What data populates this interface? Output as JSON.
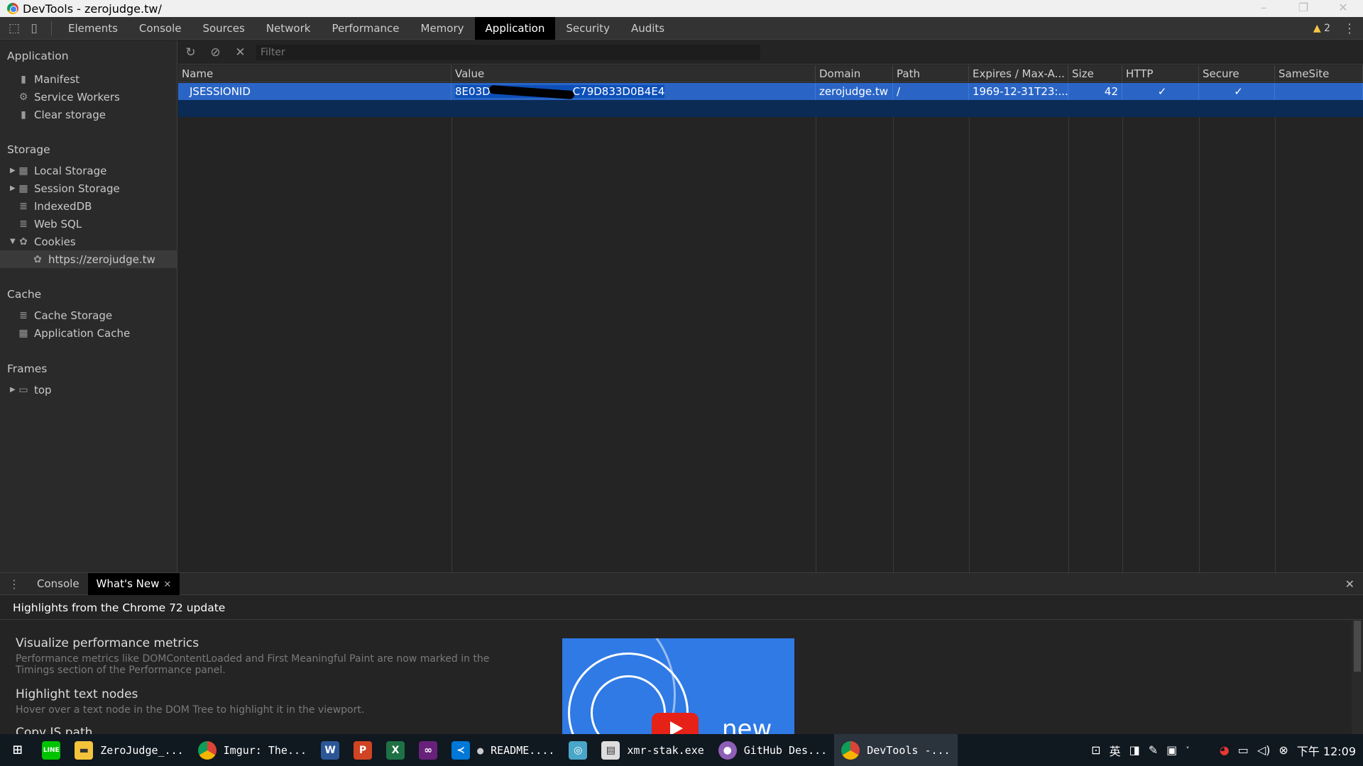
{
  "window": {
    "title": "DevTools - zerojudge.tw/"
  },
  "toolbar": {
    "tabs": [
      "Elements",
      "Console",
      "Sources",
      "Network",
      "Performance",
      "Memory",
      "Application",
      "Security",
      "Audits"
    ],
    "active_tab": "Application",
    "warning_count": "2"
  },
  "sidebar": {
    "application_header": "Application",
    "application_items": [
      "Manifest",
      "Service Workers",
      "Clear storage"
    ],
    "storage_header": "Storage",
    "storage_items": [
      "Local Storage",
      "Session Storage",
      "IndexedDB",
      "Web SQL",
      "Cookies"
    ],
    "cookie_origin": "https://zerojudge.tw",
    "cache_header": "Cache",
    "cache_items": [
      "Cache Storage",
      "Application Cache"
    ],
    "frames_header": "Frames",
    "frames_items": [
      "top"
    ]
  },
  "cookies": {
    "filter_placeholder": "Filter",
    "columns": [
      "Name",
      "Value",
      "Domain",
      "Path",
      "Expires / Max-A...",
      "Size",
      "HTTP",
      "Secure",
      "SameSite"
    ],
    "rows": [
      {
        "name": "JSESSIONID",
        "value_prefix": "8E03D",
        "value_suffix": "C79D833D0B4E4",
        "domain": "zerojudge.tw",
        "path": "/",
        "expires": "1969-12-31T23:...",
        "size": "42",
        "http": "✓",
        "secure": "✓",
        "samesite": ""
      }
    ]
  },
  "drawer": {
    "tabs": [
      "Console",
      "What's New"
    ],
    "active_tab": "What's New",
    "heading": "Highlights from the Chrome 72 update",
    "items": [
      {
        "title": "Visualize performance metrics",
        "desc": "Performance metrics like DOMContentLoaded and First Meaningful Paint are now marked in the Timings section of the Performance panel."
      },
      {
        "title": "Highlight text nodes",
        "desc": "Hover over a text node in the DOM Tree to highlight it in the viewport."
      },
      {
        "title": "Copy JS path",
        "desc": ""
      }
    ],
    "video_text": "new"
  },
  "taskbar": {
    "apps": [
      "ZeroJudge_...",
      "Imgur: The...",
      "README....",
      "xmr-stak.exe",
      "GitHub Des...",
      "DevTools -..."
    ],
    "ime": "英",
    "clock": "下午 12:09"
  }
}
